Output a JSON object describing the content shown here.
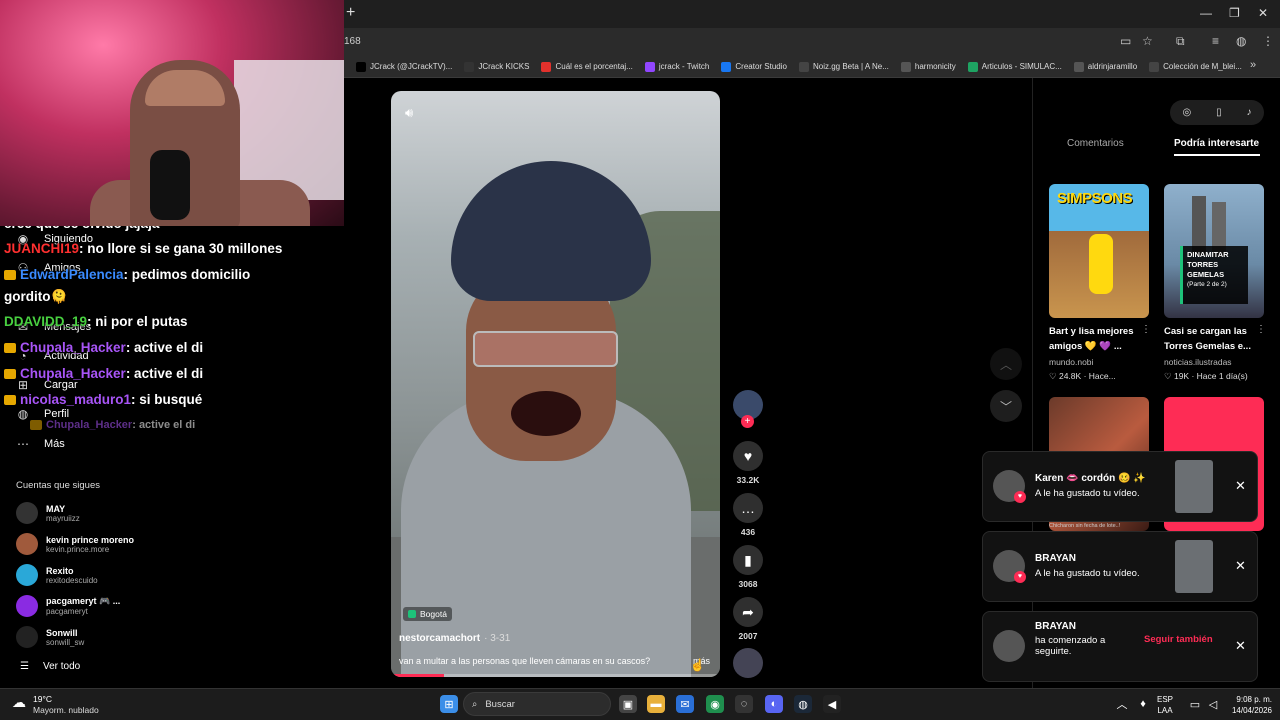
{
  "browser": {
    "new_tab": "+",
    "url_fragment": "168",
    "bookmarks": [
      {
        "label": "JCrack (@JCrackTV)...",
        "color": "#000000"
      },
      {
        "label": "JCrack KICKS",
        "color": "#333333"
      },
      {
        "label": "Cuál es el porcentaj...",
        "color": "#e2312c"
      },
      {
        "label": "jcrack - Twitch",
        "color": "#9146ff"
      },
      {
        "label": "Creator Studio",
        "color": "#1877f2"
      },
      {
        "label": "Noiz.gg Beta | A Ne...",
        "color": "#444444"
      },
      {
        "label": "harmonicity",
        "color": "#555555"
      },
      {
        "label": "Articulos - SIMULAC...",
        "color": "#1ea362"
      },
      {
        "label": "aldrinjaramillo",
        "color": "#555555"
      },
      {
        "label": "Colección de M_blei...",
        "color": "#444444"
      }
    ],
    "bookmarks_more": "»"
  },
  "sidebar": {
    "nav": [
      {
        "icon": "◉",
        "label": "Siguiendo"
      },
      {
        "icon": "⚇",
        "label": "Amigos"
      },
      {
        "icon": "✉",
        "label": "Mensajes"
      },
      {
        "icon": "◔",
        "label": "Actividad"
      },
      {
        "icon": "⊞",
        "label": "Cargar"
      },
      {
        "icon": "◍",
        "label": "Perfil"
      },
      {
        "icon": "⋯",
        "label": "Más"
      }
    ],
    "following_title": "Cuentas que sigues",
    "following": [
      {
        "name": "MAY",
        "handle": "mayruiizz",
        "color": "#333333"
      },
      {
        "name": "kevin prince moreno",
        "handle": "kevin.prince.more",
        "color": "#a05a3c"
      },
      {
        "name": "Rexito",
        "handle": "rexitodescuido",
        "color": "#2aa8d8"
      },
      {
        "name": "pacgameryt 🎮 ...",
        "handle": "pacgameryt",
        "color": "#8a2be2"
      },
      {
        "name": "Sonwill",
        "handle": "sonwill_sw",
        "color": "#222222"
      }
    ],
    "see_all_icon": "☰",
    "see_all": "Ver todo"
  },
  "chat": [
    {
      "user": "",
      "text": "cree que se olvido jajaja",
      "color": "#ffffff",
      "badge": false
    },
    {
      "user": "JUANCHI19",
      "text": ": no llore si se gana 30 millones",
      "color": "#ff3030",
      "badge": false
    },
    {
      "user": "EdwardPalencia",
      "text": ": pedimos domicilio",
      "color": "#3a8bff",
      "badge": true
    },
    {
      "user": "",
      "text": "gordito🫠",
      "color": "#ffffff",
      "badge": false
    },
    {
      "user": "DDAVIDD_19",
      "text": ": ni por el putas",
      "color": "#48d040",
      "badge": false
    },
    {
      "user": "Chupala_Hacker",
      "text": ": active el di",
      "color": "#a855f7",
      "badge": true
    },
    {
      "user": "Chupala_Hacker",
      "text": ": active el di",
      "color": "#a855f7",
      "badge": true
    },
    {
      "user": "nicolas_maduro1",
      "text": ": si busqué",
      "color": "#a855f7",
      "badge": true
    },
    {
      "user": "Chupala_Hacker",
      "text": ": active el di",
      "color": "#a855f7",
      "badge": true
    }
  ],
  "video": {
    "location": "Bogotá",
    "author": "nestorcamachort",
    "date": "· 3-31",
    "caption": "van a multar a las personas que lleven cámaras en su cascos?",
    "more": "más",
    "progress": 0.16
  },
  "actions": [
    {
      "icon": "♥",
      "count": "33.2K"
    },
    {
      "icon": "…",
      "count": "436"
    },
    {
      "icon": "▮",
      "count": "3068"
    },
    {
      "icon": "➦",
      "count": "2007"
    }
  ],
  "right_panel": {
    "tabs": [
      "Comentarios",
      "Podría interesarte"
    ],
    "videos": [
      {
        "title": "Bart y lisa mejores amigos 💛 💜 ...",
        "channel": "mundo.nobi",
        "likes": "♡ 24.8K",
        "age": "Hace...",
        "thumb_text": "SIMPSONS"
      },
      {
        "title": "Casi se cargan las Torres Gemelas e...",
        "channel": "noticias.ilustradas",
        "likes": "♡ 19K",
        "age": "Hace 1 día(s)",
        "thumb_title": "DINAMITAR TORRES GEMELAS",
        "thumb_sub": "(Parte 2 de 2)"
      }
    ],
    "tiny_caption": "Chicharon sin fecha de lote..!"
  },
  "notifications": [
    {
      "who": "Karen 👄 cordón 🥴 ✨",
      "what": "A le ha gustado tu vídeo.",
      "action": ""
    },
    {
      "who": "BRAYAN",
      "what": "A le ha gustado tu vídeo.",
      "action": ""
    },
    {
      "who": "BRAYAN",
      "what": "ha comenzado a seguirte.",
      "action": "Seguir también"
    }
  ],
  "taskbar": {
    "temp": "19°C",
    "weather": "Mayorm. nublado",
    "search": "Buscar",
    "lang1": "ESP",
    "lang2": "LAA",
    "time": "9:08 p. m.",
    "date": "14/04/2026"
  }
}
